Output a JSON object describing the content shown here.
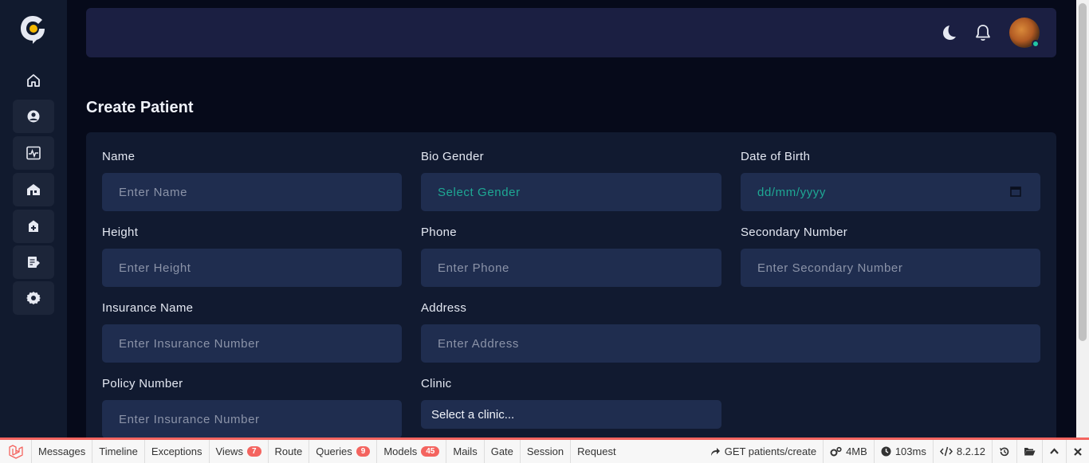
{
  "header": {
    "theme_icon": "moon-icon",
    "notification_icon": "bell-icon"
  },
  "sidebar": {
    "items": [
      {
        "icon": "home-icon"
      },
      {
        "icon": "user-circle-icon"
      },
      {
        "icon": "activity-monitor-icon"
      },
      {
        "icon": "building-icon"
      },
      {
        "icon": "medical-icon"
      },
      {
        "icon": "document-edit-icon"
      },
      {
        "icon": "gear-icon"
      }
    ]
  },
  "page": {
    "title": "Create Patient"
  },
  "form": {
    "name": {
      "label": "Name",
      "placeholder": "Enter Name"
    },
    "bio_gender": {
      "label": "Bio Gender",
      "placeholder": "Select Gender"
    },
    "dob": {
      "label": "Date of Birth",
      "placeholder": "dd/mm/yyyy"
    },
    "height": {
      "label": "Height",
      "placeholder": "Enter Height"
    },
    "phone": {
      "label": "Phone",
      "placeholder": "Enter Phone"
    },
    "secondary": {
      "label": "Secondary Number",
      "placeholder": "Enter Secondary Number"
    },
    "insurance": {
      "label": "Insurance Name",
      "placeholder": "Enter Insurance Number"
    },
    "address": {
      "label": "Address",
      "placeholder": "Enter Address"
    },
    "policy": {
      "label": "Policy Number",
      "placeholder": "Enter Insurance Number"
    },
    "clinic": {
      "label": "Clinic",
      "value": "Select a clinic..."
    }
  },
  "debugbar": {
    "tabs": [
      {
        "label": "Messages"
      },
      {
        "label": "Timeline"
      },
      {
        "label": "Exceptions"
      },
      {
        "label": "Views",
        "badge": "7"
      },
      {
        "label": "Route"
      },
      {
        "label": "Queries",
        "badge": "9"
      },
      {
        "label": "Models",
        "badge": "45"
      },
      {
        "label": "Mails"
      },
      {
        "label": "Gate"
      },
      {
        "label": "Session"
      },
      {
        "label": "Request"
      }
    ],
    "request": "GET patients/create",
    "memory": "4MB",
    "time": "103ms",
    "php_version": "8.2.12"
  },
  "colors": {
    "accent": "#f4645f",
    "teal": "#1ea894",
    "input_bg": "#1f2d4f",
    "card_bg": "#111a30"
  }
}
